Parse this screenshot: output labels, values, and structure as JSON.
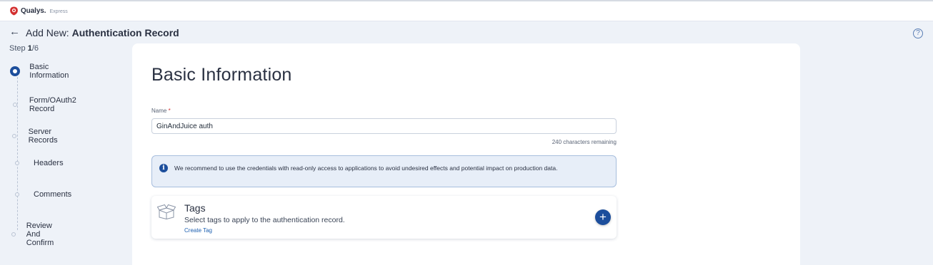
{
  "app": {
    "brand": "Qualys.",
    "brand_sub": "Express"
  },
  "header": {
    "prefix": "Add New:",
    "title": "Authentication Record",
    "help_symbol": "?"
  },
  "stepper": {
    "step_label": "Step",
    "current": "1",
    "total": "/6",
    "steps": [
      {
        "label": "Basic Information",
        "active": true
      },
      {
        "label": "Form/OAuth2 Record",
        "active": false
      },
      {
        "label": "Server Records",
        "active": false
      },
      {
        "label": "Headers",
        "active": false
      },
      {
        "label": "Comments",
        "active": false
      },
      {
        "label": "Review And Confirm",
        "active": false
      }
    ]
  },
  "form": {
    "title": "Basic Information",
    "name_label": "Name",
    "required_mark": "*",
    "name_value": "GinAndJuice auth",
    "char_remaining": "240 characters remaining",
    "info_text": "We recommend to use the credentials with read-only access to applications to avoid undesired effects and potential impact on production data."
  },
  "tags": {
    "title": "Tags",
    "description": "Select tags to apply to the authentication record.",
    "create_link": "Create Tag",
    "add_symbol": "+"
  },
  "colors": {
    "accent": "#1c4e9c",
    "logo_red": "#d32f2f",
    "background": "#eef2f8"
  }
}
